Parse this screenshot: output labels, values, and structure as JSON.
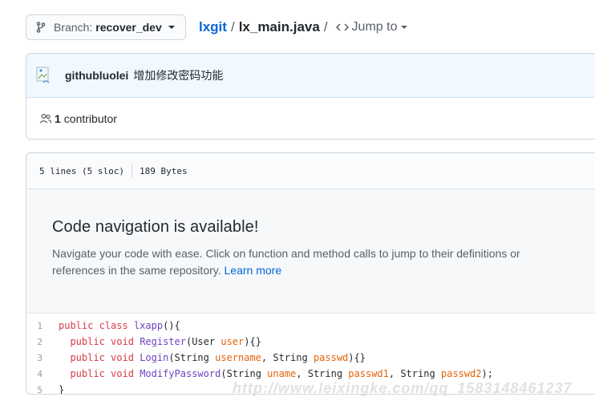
{
  "header": {
    "branch_label": "Branch:",
    "branch_name": "recover_dev",
    "repo": "lxgit",
    "separator": "/",
    "file": "lx_main.java",
    "jump_label": "Jump to"
  },
  "commit": {
    "author": "githubluolei",
    "message": "增加修改密码功能",
    "contributors_count": "1",
    "contributors_label": "contributor"
  },
  "file_info": {
    "lines": "5 lines (5 sloc)",
    "size": "189 Bytes"
  },
  "code_nav": {
    "title": "Code navigation is available!",
    "text": "Navigate your code with ease. Click on function and method calls to jump to their definitions or references in the same repository.",
    "link": "Learn more"
  },
  "code": {
    "line_numbers": [
      "1",
      "2",
      "3",
      "4",
      "5"
    ],
    "l1": {
      "kw1": "public",
      "kw2": "class",
      "name": "lxapp",
      "rest": "(){"
    },
    "l2": {
      "kw1": "public",
      "kw2": "void",
      "fn": "Register",
      "open": "(User ",
      "p1": "user",
      "close": "){}"
    },
    "l3": {
      "kw1": "public",
      "kw2": "void",
      "fn": "Login",
      "open": "(String ",
      "p1": "username",
      "mid": ", String ",
      "p2": "passwd",
      "close": "){}"
    },
    "l4": {
      "kw1": "public",
      "kw2": "void",
      "fn": "ModifyPassword",
      "open": "(String ",
      "p1": "uname",
      "mid1": ", String ",
      "p2": "passwd1",
      "mid2": ", String ",
      "p3": "passwd2",
      "close": ");"
    },
    "l5": {
      "text": "}"
    }
  },
  "watermark": "http://www.leixingke.com/qq_1583148461237",
  "colors": {
    "link": "#0366d6",
    "keyword": "#d73a49",
    "function": "#6f42c1",
    "param": "#e36209"
  },
  "icons": {
    "branch": "git-branch-icon",
    "code": "code-icon",
    "people": "people-icon",
    "avatar": "broken-avatar-icon"
  }
}
